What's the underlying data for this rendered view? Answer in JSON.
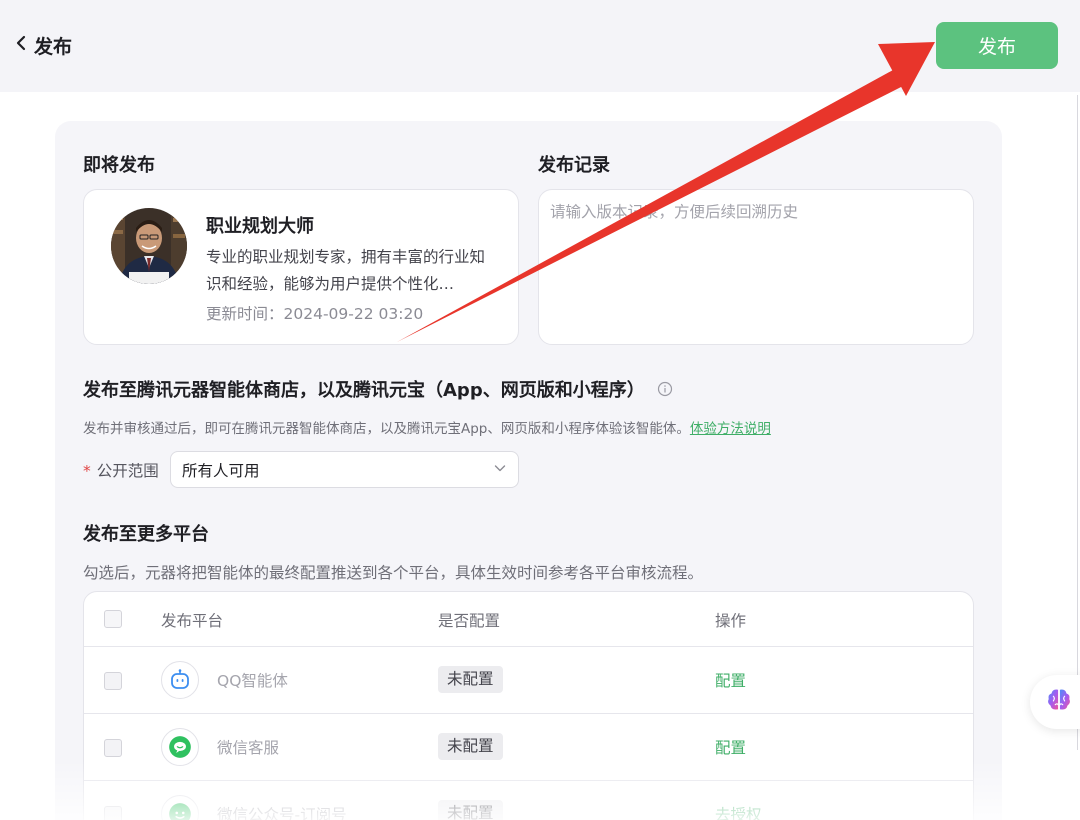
{
  "header": {
    "back_label": "发布",
    "publish_label": "发布"
  },
  "upcoming": {
    "title": "即将发布",
    "agent_name": "职业规划大师",
    "agent_desc": "专业的职业规划专家，拥有丰富的行业知识和经验，能够为用户提供个性化…",
    "update_time": "更新时间：2024-09-22 03:20"
  },
  "record": {
    "title": "发布记录",
    "placeholder": "请输入版本记录，方便后续回溯历史"
  },
  "store": {
    "title": "发布至腾讯元器智能体商店，以及腾讯元宝（App、网页版和小程序）",
    "desc": "发布并审核通过后，即可在腾讯元器智能体商店，以及腾讯元宝App、网页版和小程序体验该智能体。",
    "link_label": "体验方法说明",
    "scope_required": "*",
    "scope_label": "公开范围",
    "scope_value": "所有人可用"
  },
  "more": {
    "title": "发布至更多平台",
    "desc": "勾选后，元器将把智能体的最终配置推送到各个平台，具体生效时间参考各平台审核流程。"
  },
  "table": {
    "headers": [
      "发布平台",
      "是否配置",
      "操作"
    ],
    "rows": [
      {
        "platform": "QQ智能体",
        "status": "未配置",
        "action": "配置",
        "icon": "qq-bot-icon"
      },
      {
        "platform": "微信客服",
        "status": "未配置",
        "action": "配置",
        "icon": "wechat-icon"
      },
      {
        "platform": "微信公众号-订阅号",
        "status": "未配置",
        "action": "去授权",
        "icon": "wechat-official-icon"
      }
    ]
  },
  "colors": {
    "accent_green": "#5cc27f",
    "link_green": "#3fae67",
    "annotation_red": "#e8352b"
  }
}
